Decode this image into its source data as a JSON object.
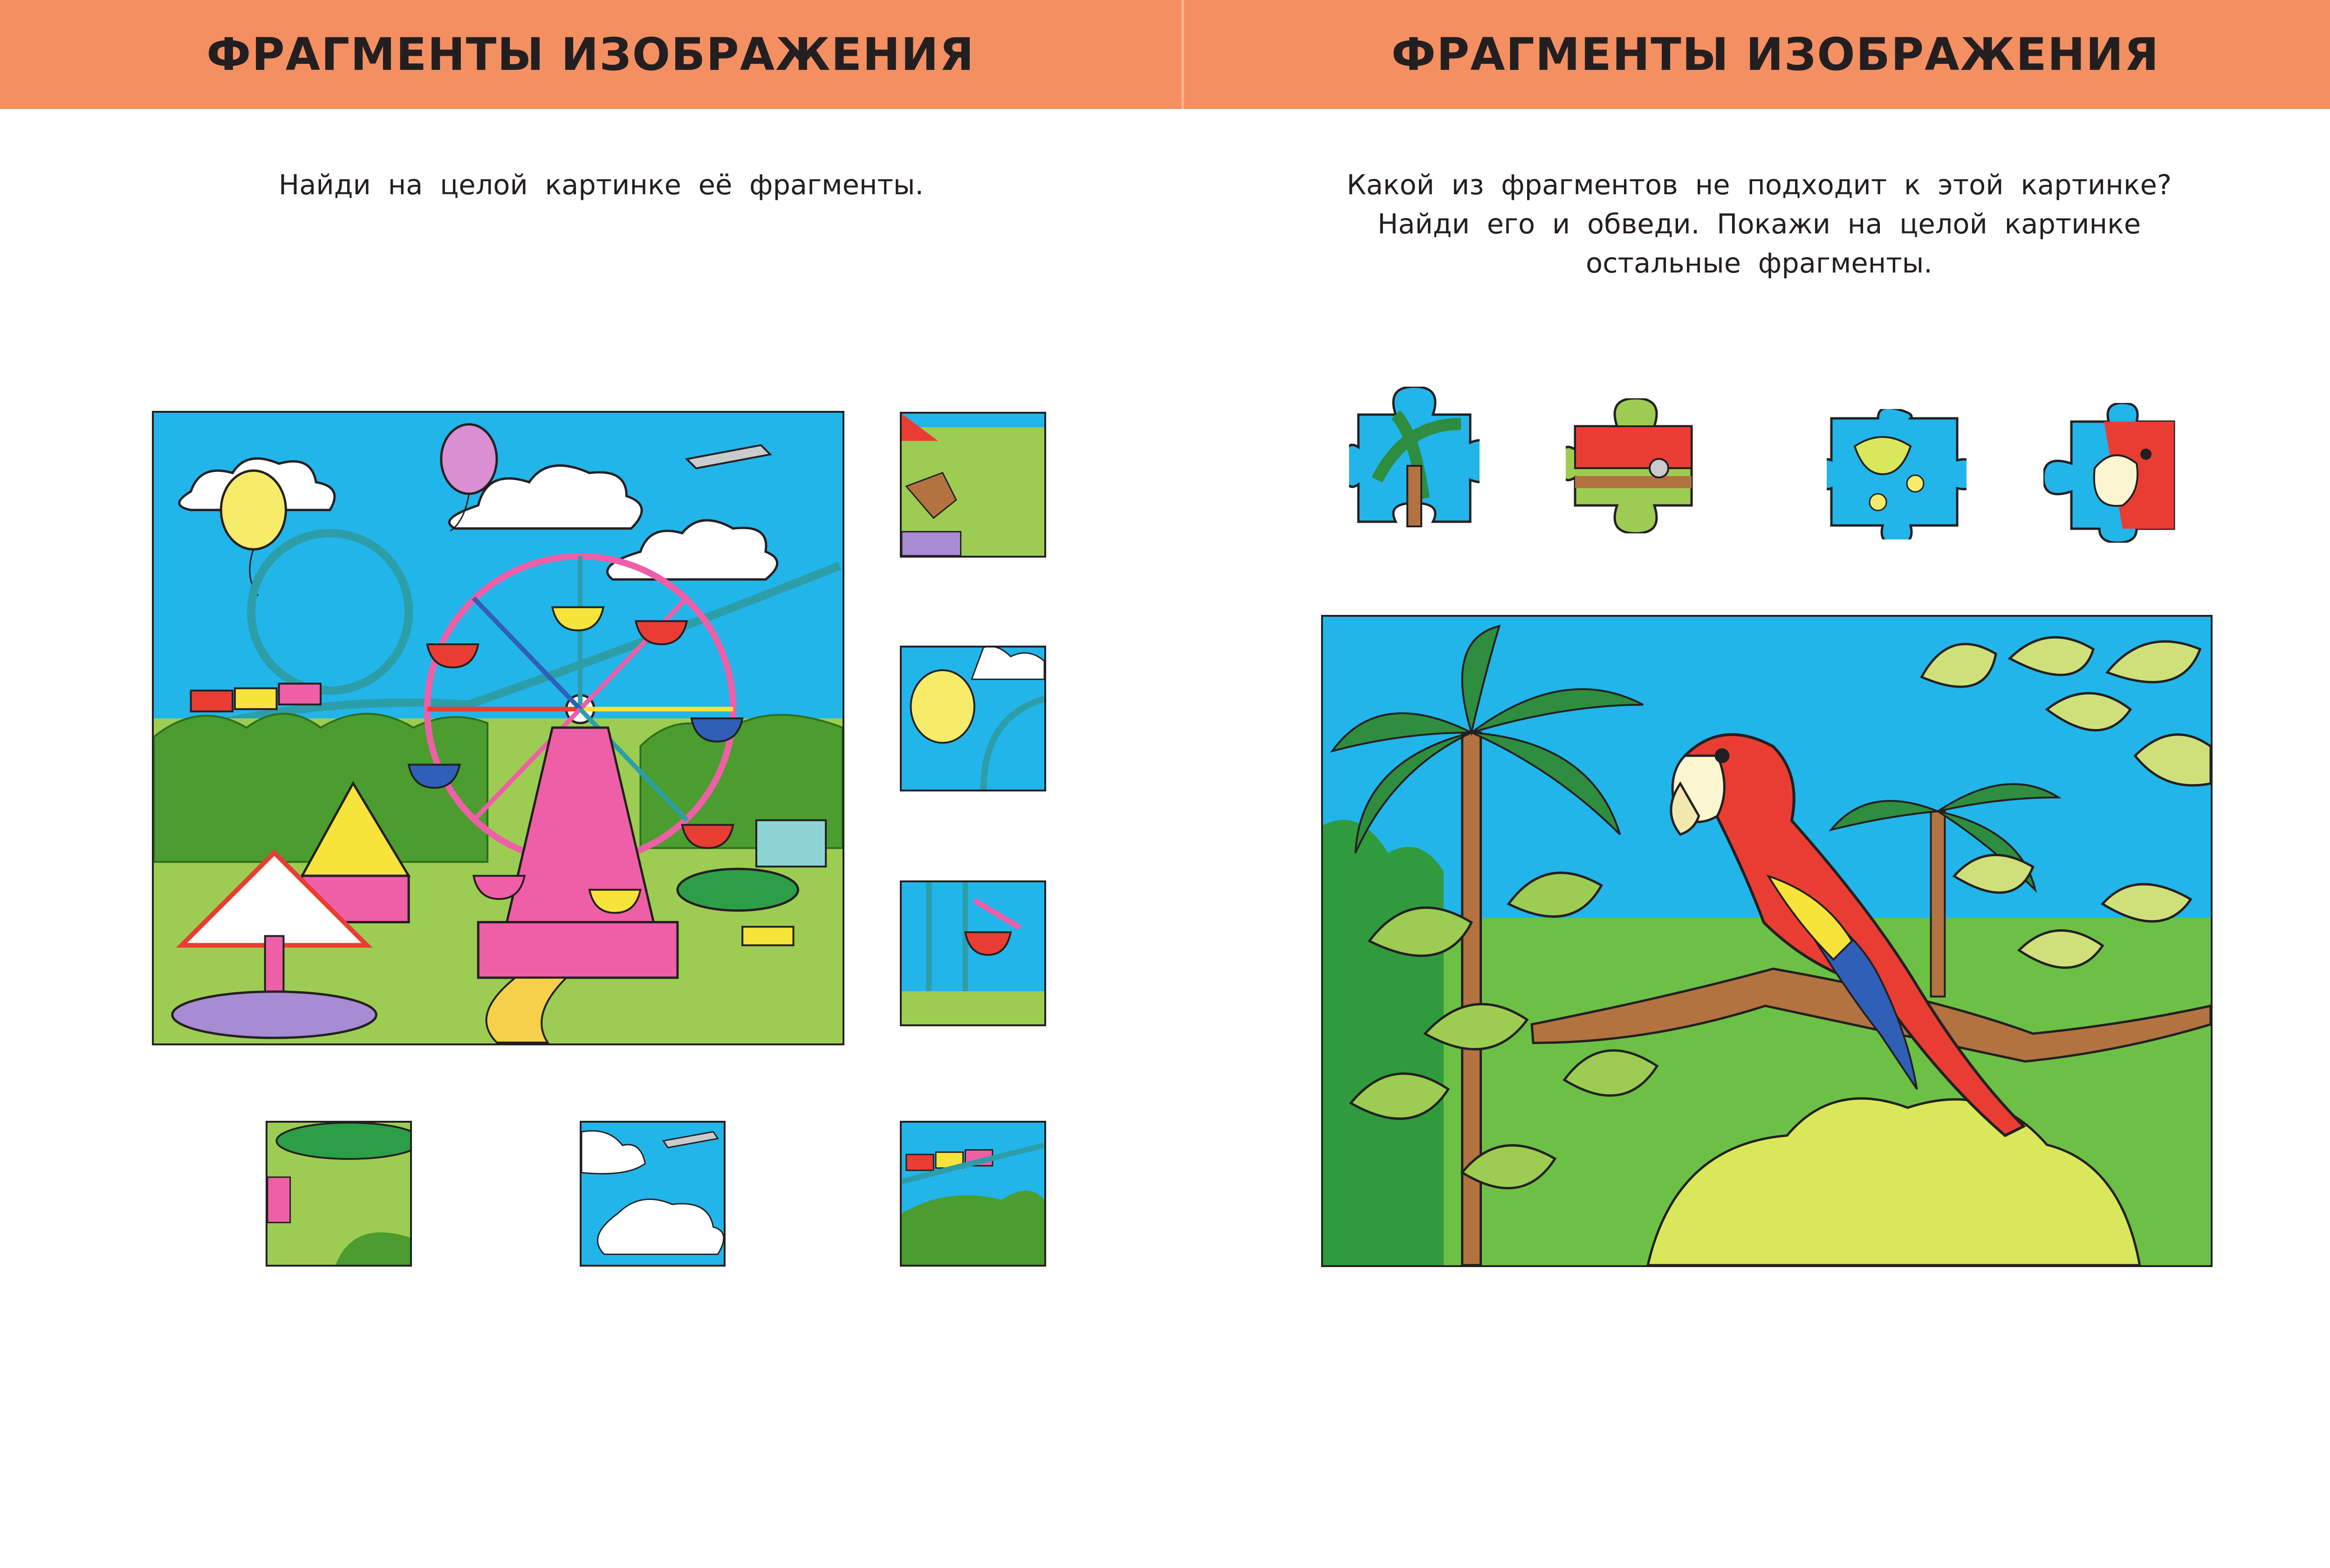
{
  "left_page": {
    "header_title": "ФРАГМЕНТЫ ИЗОБРАЖЕНИЯ",
    "instruction": "Найди на целой картинке её фрагменты.",
    "main_picture": "amusement-park-picture",
    "fragment_count": 6
  },
  "right_page": {
    "header_title": "ФРАГМЕНТЫ ИЗОБРАЖЕНИЯ",
    "instruction_lines": [
      "Какой из фрагментов не подходит к этой картинке?",
      "Найди его и обведи. Покажи на целой картинке",
      "остальные фрагменты."
    ],
    "main_picture": "parrot-jungle-picture",
    "puzzle_piece_count": 4
  },
  "colors": {
    "header": "#f48f62",
    "sky": "#22b5ea",
    "grass": "#9ccd52",
    "text": "#231f20"
  }
}
